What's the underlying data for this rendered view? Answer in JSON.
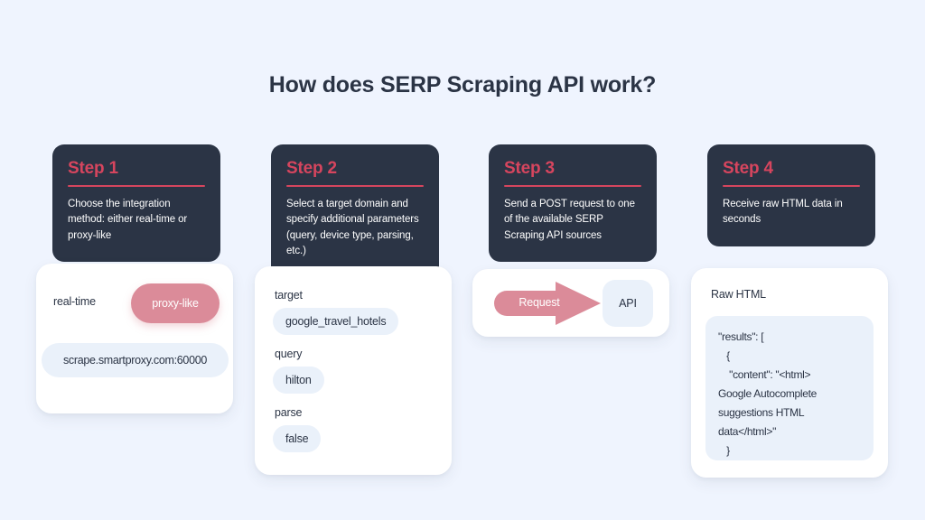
{
  "page": {
    "title": "How does SERP Scraping API work?",
    "background_color": "#eff4fe",
    "accent_color": "#d6455e",
    "dark_color": "#2b3445",
    "pink_color": "#db8b99",
    "pill_color": "#eaf1fa"
  },
  "steps": [
    {
      "label": "Step 1",
      "description": "Choose the integration method: either real-time or proxy-like",
      "body": {
        "realtime_option": "real-time",
        "proxylike_option": "proxy-like",
        "proxy_host": "scrape.smartproxy.com:60000"
      }
    },
    {
      "label": "Step 2",
      "description": "Select a target domain and specify additional parameters (query, device type, parsing, etc.)",
      "body": {
        "params": [
          {
            "label": "target",
            "value": "google_travel_hotels"
          },
          {
            "label": "query",
            "value": "hilton"
          },
          {
            "label": "parse",
            "value": "false"
          }
        ]
      }
    },
    {
      "label": "Step 3",
      "description": "Send a POST request to one of the available SERP Scraping API sources",
      "body": {
        "arrow_label": "Request",
        "api_label": "API"
      }
    },
    {
      "label": "Step 4",
      "description": "Receive raw HTML data in seconds",
      "body": {
        "raw_html_label": "Raw HTML",
        "code": "\"results\": [\n   {\n    \"content\": \"<html>\nGoogle Autocomplete\nsuggestions HTML\ndata</html>\"\n   }"
      }
    }
  ]
}
